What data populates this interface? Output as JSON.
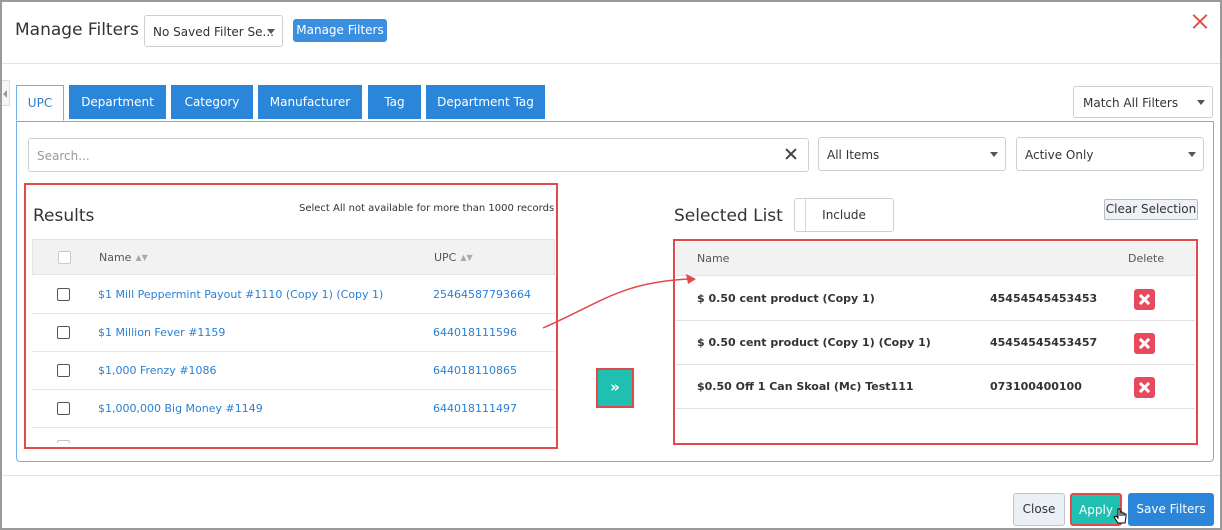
{
  "header": {
    "title": "Manage Filters",
    "saved_filter_select": "No Saved Filter Se...",
    "manage_filters_button": "Manage Filters"
  },
  "tabs": [
    {
      "label": "UPC",
      "active": true
    },
    {
      "label": "Department",
      "active": false
    },
    {
      "label": "Category",
      "active": false
    },
    {
      "label": "Manufacturer",
      "active": false
    },
    {
      "label": "Tag",
      "active": false
    },
    {
      "label": "Department Tag",
      "active": false
    }
  ],
  "match_select": "Match All Filters",
  "search": {
    "placeholder": "Search..."
  },
  "items_select": "All Items",
  "status_select": "Active Only",
  "results": {
    "title": "Results",
    "note": "Select All not available for more than 1000 records",
    "columns": {
      "name": "Name",
      "upc": "UPC"
    },
    "rows": [
      {
        "name": "$1 Mill Peppermint Payout #1110 (Copy 1) (Copy 1)",
        "upc": "25464587793664"
      },
      {
        "name": "$1 Million Fever #1159",
        "upc": "644018111596"
      },
      {
        "name": "$1,000 Frenzy #1086",
        "upc": "644018110865"
      },
      {
        "name": "$1,000,000 Big Money #1149",
        "upc": "644018111497"
      }
    ]
  },
  "selected": {
    "title": "Selected List",
    "include_button": "Include",
    "clear_button": "Clear Selection",
    "columns": {
      "name": "Name",
      "delete": "Delete"
    },
    "rows": [
      {
        "name": "$ 0.50 cent product (Copy 1)",
        "upc": "45454545453453"
      },
      {
        "name": "$ 0.50 cent product (Copy 1) (Copy 1)",
        "upc": "45454545453457"
      },
      {
        "name": "$0.50 Off 1 Can Skoal (Mc) Test111",
        "upc": "073100400100"
      }
    ]
  },
  "move_button_glyph": "»",
  "footer": {
    "close": "Close",
    "apply": "Apply",
    "save": "Save Filters"
  },
  "colors": {
    "primary_blue": "#2b86d9",
    "teal": "#1fbfb1",
    "highlight_red": "#e04a4a",
    "delete_red": "#e8495d"
  }
}
